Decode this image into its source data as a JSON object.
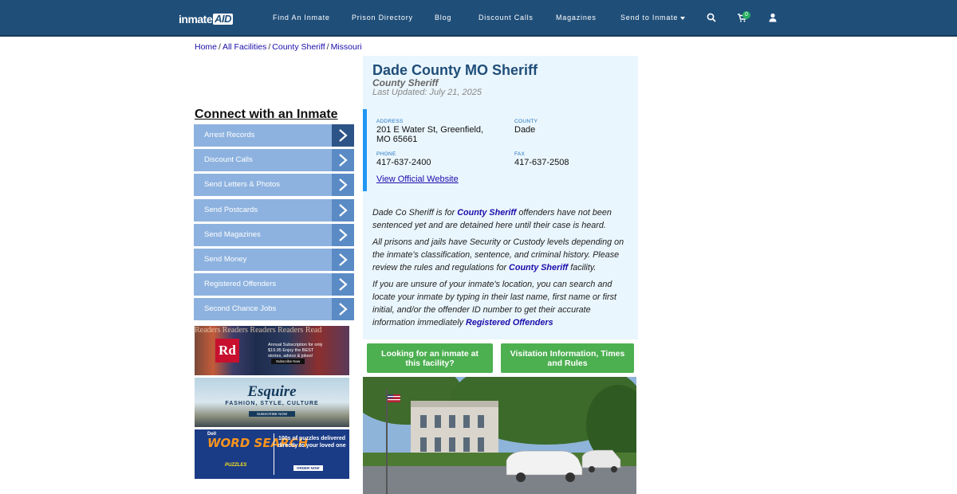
{
  "nav": {
    "logo_main": "inmate",
    "logo_accent": "AID",
    "items": [
      "Find An Inmate",
      "Prison Directory",
      "Blog",
      "Discount Calls",
      "Magazines",
      "Send to Inmate"
    ],
    "cart_count": "0",
    "icons": [
      "search-icon",
      "cart-icon",
      "user-icon"
    ]
  },
  "breadcrumb": {
    "items": [
      "Home",
      "All Facilities",
      "County Sheriff",
      "Missouri"
    ]
  },
  "sidebar": {
    "title": "Connect with an Inmate",
    "items": [
      "Arrest Records",
      "Discount Calls",
      "Send Letters & Photos",
      "Send Postcards",
      "Send Magazines",
      "Send Money",
      "Registered Offenders",
      "Second Chance Jobs"
    ],
    "ads": {
      "rd": {
        "logo": "Rd",
        "text": "Annual Subscription for only $19.95 Enjoy the BEST stories, advice & jokes!",
        "button": "Subscribe Now"
      },
      "esquire": {
        "logo": "Esquire",
        "tagline": "FASHION, STYLE, CULTURE",
        "button": "SUBSCRIBE NOW"
      },
      "wordsearch": {
        "brand": "Dell",
        "title": "WORD SEARCH",
        "subtitle": "PUZZLES",
        "text": "100s of puzzles delivered directly to your loved one",
        "button": "ORDER NOW"
      }
    }
  },
  "facility": {
    "name": "Dade County MO Sheriff",
    "type": "County Sheriff",
    "last_updated": "Last Updated: July 21, 2025",
    "address_label": "ADDRESS",
    "address_line1": "201 E Water St, Greenfield,",
    "address_line2": "MO 65661",
    "county_label": "COUNTY",
    "county": "Dade",
    "phone_label": "PHONE",
    "phone": "417-637-2400",
    "fax_label": "FAX",
    "fax": "417-637-2508",
    "website_link": "View Official Website"
  },
  "description": {
    "p1_a": "Dade Co Sheriff is for ",
    "p1_link": "County Sheriff",
    "p1_b": " offenders have not been sentenced yet and are detained here until their case is heard.",
    "p2_a": "All prisons and jails have Security or Custody levels depending on the inmate's classification, sentence, and criminal history. Please review the rules and regulations for ",
    "p2_link": "County Sheriff",
    "p2_b": " facility.",
    "p3_a": "If you are unsure of your inmate's location, you can search and locate your inmate by typing in their last name, first name or first initial, and/or the offender ID number to get their accurate information immediately",
    "p3_link": "Registered Offenders"
  },
  "buttons": {
    "looking": "Looking for an inmate at this facility?",
    "visitation": "Visitation Information, Times and Rules"
  },
  "colors": {
    "nav_bg": "#1f4e79",
    "panel_bg": "#eaf6fd",
    "accent_blue": "#2196f3",
    "side_item": "#8db2df",
    "green": "#4caf50"
  }
}
